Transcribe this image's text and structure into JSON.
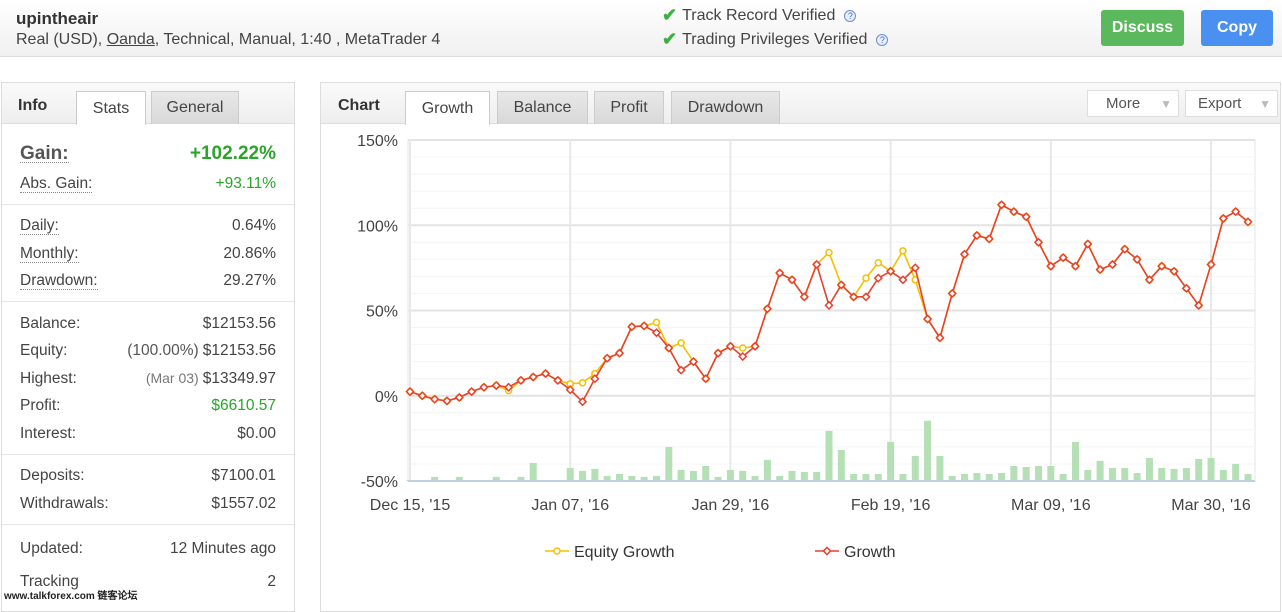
{
  "header": {
    "name": "upintheair",
    "desc_pre": "Real (USD), ",
    "broker": "Oanda",
    "desc_post": ", Technical, Manual, 1:40 , MetaTrader 4",
    "verifications": [
      {
        "label": "Track Record Verified",
        "icon": "check-icon"
      },
      {
        "label": "Trading Privileges Verified",
        "icon": "check-icon"
      }
    ],
    "discuss": "Discuss",
    "copy": "Copy",
    "colors": {
      "discuss": "#5cb85c",
      "copy": "#4a90f0"
    }
  },
  "info": {
    "title": "Info",
    "tabs": [
      "Stats",
      "General"
    ],
    "gain_label": "Gain:",
    "gain": "+102.22%",
    "abs_gain_label": "Abs. Gain:",
    "abs_gain": "+93.11%",
    "daily_label": "Daily:",
    "daily": "0.64%",
    "monthly_label": "Monthly:",
    "monthly": "20.86%",
    "drawdown_label": "Drawdown:",
    "drawdown": "29.27%",
    "balance_label": "Balance:",
    "balance": "$12153.56",
    "equity_label": "Equity:",
    "equity_pct": "(100.00%)",
    "equity": "$12153.56",
    "highest_label": "Highest:",
    "highest_date": "(Mar 03)",
    "highest": "$13349.97",
    "profit_label": "Profit:",
    "profit": "$6610.57",
    "interest_label": "Interest:",
    "interest": "$0.00",
    "deposits_label": "Deposits:",
    "deposits": "$7100.01",
    "withdrawals_label": "Withdrawals:",
    "withdrawals": "$1557.02",
    "updated_label": "Updated:",
    "updated": "12 Minutes ago",
    "tracking_label": "Tracking",
    "tracking": "2"
  },
  "chart_panel": {
    "title": "Chart",
    "tabs": [
      "Growth",
      "Balance",
      "Profit",
      "Drawdown"
    ],
    "active_tab": "Growth",
    "more": "More",
    "export": "Export"
  },
  "watermark": "www.talkforex.com 链客论坛",
  "chart_data": {
    "type": "line",
    "ylim": [
      -50,
      150
    ],
    "yticks": [
      "150%",
      "100%",
      "50%",
      "0%",
      "-50%"
    ],
    "ytick_values": [
      150,
      100,
      50,
      0,
      -50
    ],
    "xticks": [
      {
        "label": "Dec 15, '15",
        "index": 0
      },
      {
        "label": "Jan 07, '16",
        "index": 13
      },
      {
        "label": "Jan 29, '16",
        "index": 26
      },
      {
        "label": "Feb 19, '16",
        "index": 39
      },
      {
        "label": "Mar 09, '16",
        "index": 52
      },
      {
        "label": "Mar 30, '16",
        "index": 65
      }
    ],
    "grid": true,
    "legend": "bottom",
    "series": [
      {
        "name": "Equity Growth",
        "color": "#f5c000",
        "values": [
          2.4,
          0,
          -2,
          -3,
          -1,
          2.4,
          5,
          6,
          3,
          9,
          11,
          13,
          9,
          7,
          7.6,
          13,
          22,
          25,
          40.5,
          41,
          43,
          28,
          31,
          20,
          10,
          25,
          29,
          28,
          29,
          51,
          72,
          68,
          58,
          77,
          84,
          65,
          58,
          69,
          78,
          73,
          85,
          68,
          45,
          34,
          60,
          83,
          94,
          92,
          112,
          108,
          105,
          90,
          76,
          81,
          76,
          89,
          74,
          77,
          86,
          80,
          68,
          76,
          73,
          63,
          53,
          77,
          104,
          108,
          102
        ]
      },
      {
        "name": "Growth",
        "color": "#e8412c",
        "values": [
          2.4,
          0,
          -2,
          -3,
          -1,
          2.4,
          5,
          6,
          5,
          9,
          11,
          13,
          9,
          3.5,
          -3.5,
          10,
          22,
          25,
          40.5,
          41,
          37,
          28,
          15,
          20,
          10,
          25,
          29,
          23,
          29,
          51,
          72,
          68,
          58,
          77,
          53,
          65,
          58,
          58,
          69,
          73,
          68,
          75,
          45,
          34,
          60,
          83,
          94,
          92,
          112,
          108,
          105,
          90,
          76,
          81,
          76,
          89,
          74,
          77,
          86,
          80,
          68,
          76,
          73,
          63,
          53,
          77,
          104,
          108,
          102
        ]
      }
    ],
    "bars": {
      "color": "#b5dfb5",
      "values": [
        -49.4,
        -49.4,
        -47.6,
        -49.4,
        -47.6,
        -49.4,
        -49.4,
        -47.6,
        -49.4,
        -47.6,
        -39.4,
        -49.4,
        -49.4,
        -42.4,
        -44.1,
        -42.9,
        -47.1,
        -45.9,
        -47.1,
        -47.6,
        -47.1,
        -30,
        -43.5,
        -44.1,
        -41.2,
        -47.6,
        -43.5,
        -44.1,
        -47.1,
        -37.6,
        -47.1,
        -44.1,
        -44.7,
        -44.7,
        -20.6,
        -31.8,
        -45.9,
        -45.9,
        -45.9,
        -27.1,
        -45.9,
        -35.3,
        -14.7,
        -35.3,
        -47.1,
        -45.9,
        -45.3,
        -45.9,
        -45.3,
        -41.2,
        -41.8,
        -41.2,
        -41.2,
        -45.9,
        -27.1,
        -43.5,
        -38.2,
        -42.4,
        -42.4,
        -45.3,
        -36.5,
        -42.4,
        -42.9,
        -42.4,
        -37.1,
        -36.5,
        -43.5,
        -40,
        -45.9
      ]
    }
  }
}
